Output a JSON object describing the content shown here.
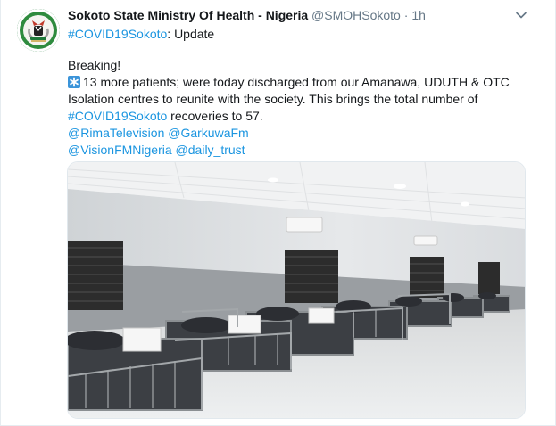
{
  "tweet": {
    "author_name": "Sokoto State Ministry Of Health - Nigeria",
    "handle": "@SMOHSokoto",
    "separator": "·",
    "time": "1h",
    "subline_hashtag": "#COVID19Sokoto",
    "subline_rest": ": Update",
    "body": {
      "line1": "Breaking!",
      "line2": "13 more patients; were today discharged from our Amanawa, UDUTH & OTC",
      "line3": "Isolation centres  to reunite with the society. This brings the total number of",
      "line4_hashtag": "#COVID19Sokoto",
      "line4_rest": " recoveries  to 57.",
      "mention1": "@RimaTelevision",
      "mention2": "@GarkuwaFm",
      "mention3": "@VisionFMNigeria",
      "mention4": "@daily_trust"
    },
    "icons": {
      "avatar": "coat-of-arms-icon",
      "caret": "chevron-down-icon",
      "emoji": "asterisk-emoji-icon"
    },
    "colors": {
      "link": "#1b95e0",
      "muted": "#657786",
      "text": "#14171a"
    }
  }
}
